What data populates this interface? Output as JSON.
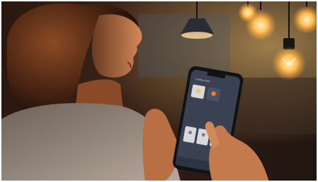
{
  "image": {
    "description_labels": [],
    "palette": {
      "warm_light": "#ffbe58",
      "bg_dark": "#2c1a12",
      "skin": "#c87a4d",
      "phone_screen": "#3a4152",
      "phone_frame": "#101216"
    }
  },
  "phone_app": {
    "screen_title": "Living room",
    "tiles": [
      {
        "state": "on"
      },
      {
        "state": "on-warm"
      },
      {
        "state": "on"
      },
      {
        "state": "on"
      },
      {
        "state": "on"
      }
    ]
  }
}
